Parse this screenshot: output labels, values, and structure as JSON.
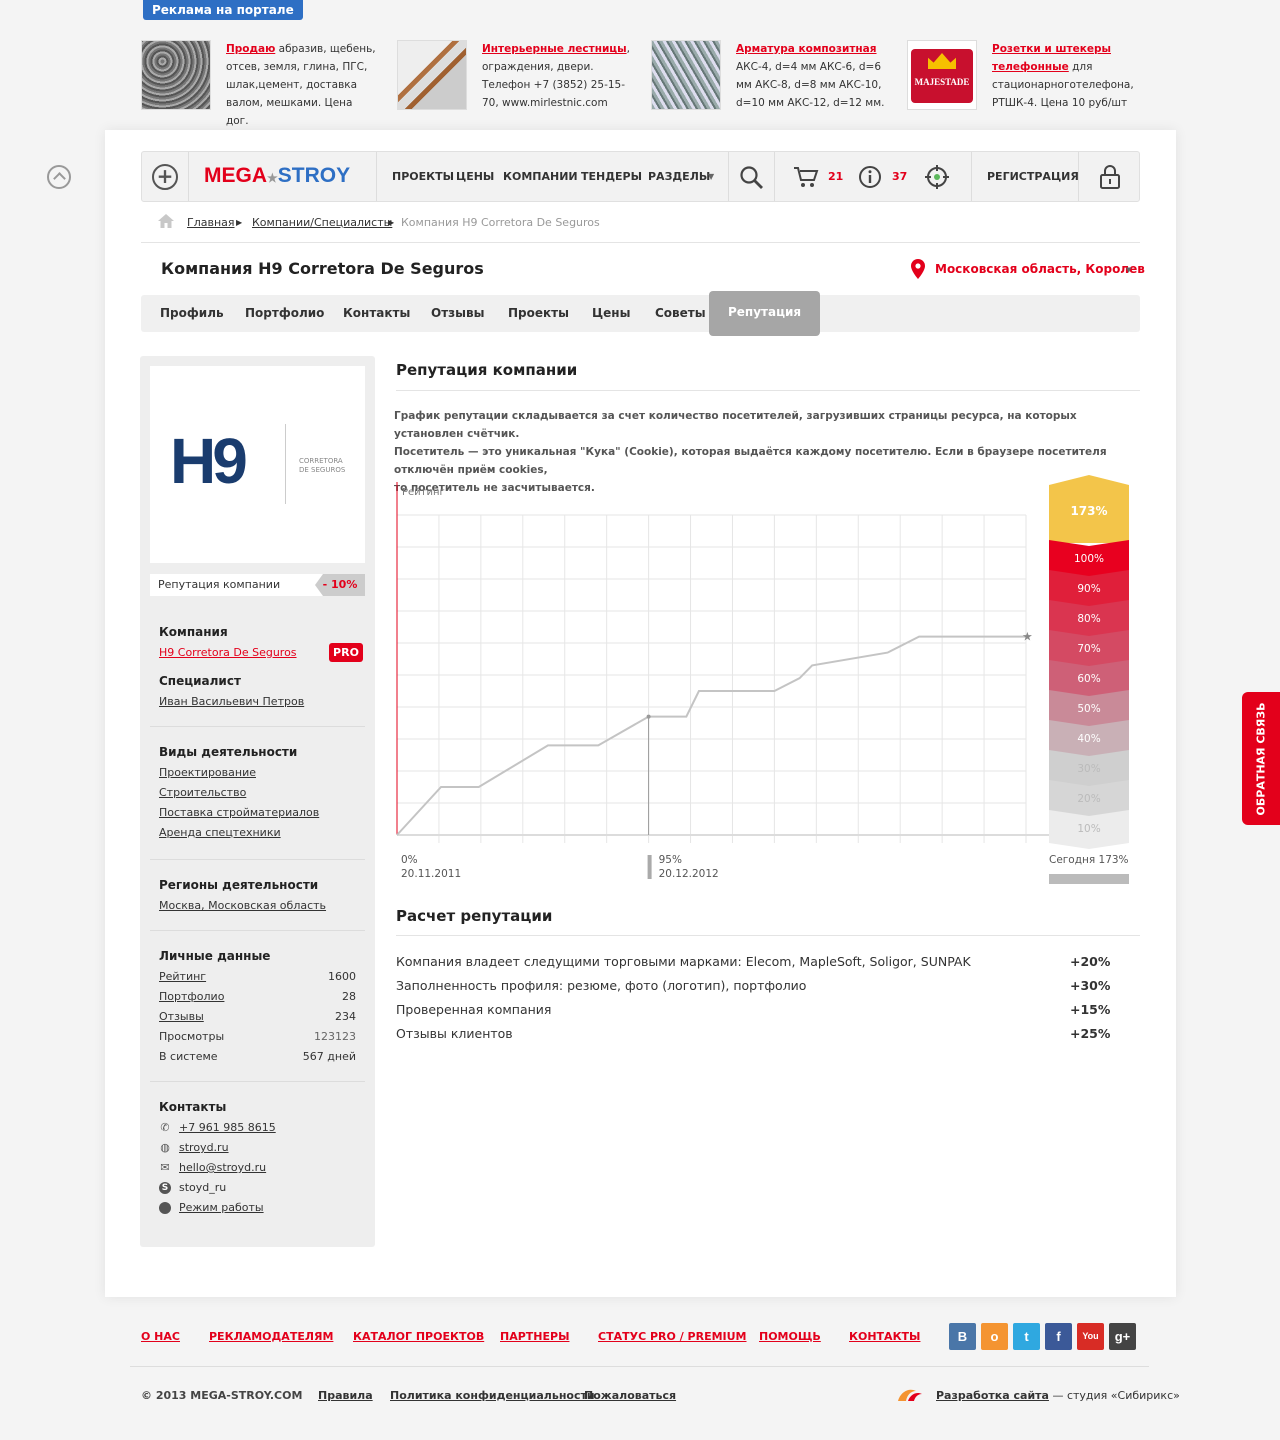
{
  "ads": {
    "label": "Реклама на портале",
    "items": [
      {
        "link": "Продаю",
        "text": " абразив, щебень, отсев, земля, глина, ПГС, шлак,цемент, доставка валом, мешками. Цена дог."
      },
      {
        "link": "Интерьерные лестницы",
        "text": ", ограждения, двери. Телефон +7 (3852) 25-15-70, www.mirlestnic.com"
      },
      {
        "link": "Арматура композитная",
        "text": " АКС-4, d=4 мм АКС-6, d=6 мм АКС-8, d=8 мм АКС-10, d=10 мм АКС-12, d=12 мм."
      },
      {
        "link": "Розетки и штекеры телефонные",
        "text": " для стационарноготелефона, РТШК-4. Цена 10 руб/шт"
      }
    ],
    "brand_text": "MAJESTADE"
  },
  "nav": {
    "logo_mega": "MEGA",
    "logo_star": "★",
    "logo_stroy": "STROY",
    "items": [
      "ПРОЕКТЫ",
      "ЦЕНЫ",
      "КОМПАНИИ",
      "ТЕНДЕРЫ",
      "РАЗДЕЛЫ"
    ],
    "cart_count": "21",
    "info_count": "37",
    "register": "РЕГИСТРАЦИЯ"
  },
  "breadcrumb": {
    "home": "Главная",
    "companies": "Компании/Специалисты",
    "current": "Компания H9 Corretora De Seguros"
  },
  "page": {
    "title": "Компания H9 Corretora De Seguros",
    "region": "Московская область, Королев"
  },
  "tabs": [
    "Профиль",
    "Портфолио",
    "Контакты",
    "Отзывы",
    "Проекты",
    "Цены",
    "Советы",
    "Репутация"
  ],
  "sidebar": {
    "logo_h9": "H9",
    "logo_sub1": "CORRETORA",
    "logo_sub2": "DE SEGUROS",
    "rep_label": "Репутация компании",
    "rep_value": "- 10%",
    "company_h": "Компания",
    "company_link": "H9 Corretora De Seguros",
    "pro": "PRO",
    "spec_h": "Специалист",
    "spec_link": "Иван Васильевич Петров",
    "activity_h": "Виды деятельности",
    "activities": [
      "Проектирование",
      "Строительство",
      "Поставка стройматериалов",
      "Аренда спецтехники"
    ],
    "regions_h": "Регионы деятельности",
    "regions": "Москва, Московская область",
    "personal_h": "Личные данные",
    "personal": [
      {
        "label": "Рейтинг",
        "value": "1600"
      },
      {
        "label": "Портфолио",
        "value": "28"
      },
      {
        "label": "Отзывы",
        "value": "234"
      },
      {
        "label": "Просмотры",
        "value": "123123"
      },
      {
        "label": "В системе",
        "value": "567 дней"
      }
    ],
    "contacts_h": "Контакты",
    "contacts": [
      "+7 961 985 8615",
      "stroyd.ru",
      "hello@stroyd.ru",
      "stoyd_ru",
      "Режим работы"
    ]
  },
  "reputation": {
    "title": "Репутация компании",
    "desc1": "График репутации складывается за счет  количество посетителей, загрузивших страницы ресурса, на которых установлен счётчик.",
    "desc2": "Посетитель — это уникальная \"Кука\" (Cookie), которая выдаётся каждому посетителю. Если в браузере посетителя отключён приём cookies,",
    "desc3": "то посетитель не засчитывается."
  },
  "chart_data": {
    "type": "line",
    "ylabel": "Рейтинг",
    "ylim": [
      0,
      100
    ],
    "x_frac": [
      0,
      0.07,
      0.13,
      0.24,
      0.32,
      0.4,
      0.46,
      0.48,
      0.5,
      0.6,
      0.64,
      0.66,
      0.78,
      0.83,
      1
    ],
    "values": [
      0,
      15,
      15,
      28,
      28,
      37,
      37,
      45,
      45,
      45,
      49,
      53,
      57,
      62,
      62
    ],
    "start_label_pct": "0%",
    "start_label_date": "20.11.2011",
    "marker_label_pct": "95%",
    "marker_label_date": "20.12.2012",
    "today_label": "Сегодня 173%",
    "scale_top": "173%",
    "scale": [
      "100%",
      "90%",
      "80%",
      "70%",
      "60%",
      "50%",
      "40%",
      "30%",
      "20%",
      "10%"
    ],
    "scale_colors": [
      "#e8001f",
      "#e01f3a",
      "#da3550",
      "#d44a63",
      "#ce6077",
      "#c98a98",
      "#c9b0b6",
      "#cfcfcf",
      "#d6d6d6",
      "#ececec"
    ]
  },
  "calc": {
    "title": "Расчет репутации",
    "rows": [
      {
        "label": "Компания владеет следущими торговыми марками: Elecom, MapleSoft, Soligor, SUNPAK",
        "value": "+20%"
      },
      {
        "label": "Заполненность профиля: резюме, фото (логотип), портфолио",
        "value": "+30%"
      },
      {
        "label": "Проверенная компания",
        "value": "+15%"
      },
      {
        "label": "Отзывы клиентов",
        "value": "+25%"
      }
    ]
  },
  "feedback": "ОБРАТНАЯ СВЯЗЬ",
  "footer": {
    "nav": [
      "О НАС",
      "РЕКЛАМОДАТЕЛЯМ",
      "КАТАЛОГ ПРОЕКТОВ",
      "ПАРТНЕРЫ",
      "СТАТУС PRO / PREMIUM",
      "ПОМОЩЬ",
      "КОНТАКТЫ"
    ],
    "social": [
      {
        "label": "В",
        "color": "#4a76a8"
      },
      {
        "label": "о",
        "color": "#f49431"
      },
      {
        "label": "t",
        "color": "#2fa8e0"
      },
      {
        "label": "f",
        "color": "#3b5998"
      },
      {
        "label": "You",
        "color": "#d82c25"
      },
      {
        "label": "g+",
        "color": "#444444"
      }
    ],
    "copyright": "© 2013 MEGA-STROY.COM",
    "rules": "Правила",
    "privacy": "Политика конфиденциальности",
    "complain": "Пожаловаться",
    "dev": "Разработка сайта",
    "dev_studio": " — студия «Сибирикс»"
  }
}
